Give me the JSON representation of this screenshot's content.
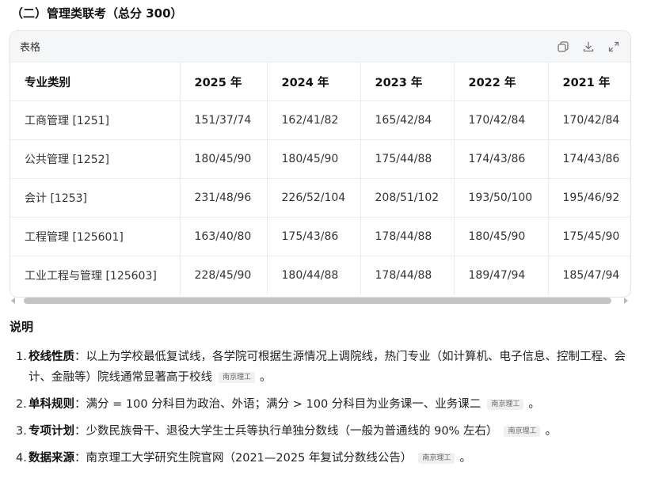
{
  "section_title": "（二）管理类联考（总分 300）",
  "table_card": {
    "label": "表格",
    "icons": [
      "copy-icon",
      "download-icon",
      "expand-icon"
    ]
  },
  "table": {
    "headers": [
      "专业类别",
      "2025 年",
      "2024 年",
      "2023 年",
      "2022 年",
      "2021 年"
    ],
    "rows": [
      [
        "工商管理 [1251]",
        "151/37/74",
        "162/41/82",
        "165/42/84",
        "170/42/84",
        "170/42/84"
      ],
      [
        "公共管理 [1252]",
        "180/45/90",
        "180/45/90",
        "175/44/88",
        "174/43/86",
        "174/43/86"
      ],
      [
        "会计 [1253]",
        "231/48/96",
        "226/52/104",
        "208/51/102",
        "193/50/100",
        "195/46/92"
      ],
      [
        "工程管理 [125601]",
        "163/40/80",
        "175/43/86",
        "178/44/88",
        "180/45/90",
        "175/45/90"
      ],
      [
        "工业工程与管理 [125603]",
        "228/45/90",
        "180/44/88",
        "178/44/88",
        "189/47/94",
        "185/47/94"
      ]
    ]
  },
  "notes_title": "说明",
  "notes": [
    {
      "num": "1.",
      "term": "校线性质",
      "text": "：以上为学校最低复试线，各学院可根据生源情况上调院线，热门专业（如计算机、电子信息、控制工程、会计、金融等）院线通常显著高于校线",
      "tag": "南京理工",
      "end": "。"
    },
    {
      "num": "2.",
      "term": "单科规则",
      "text": "：满分 = 100 分科目为政治、外语；满分 > 100 分科目为业务课一、业务课二",
      "tag": "南京理工",
      "end": "。"
    },
    {
      "num": "3.",
      "term": "专项计划",
      "text": "：少数民族骨干、退役大学生士兵等执行单独分数线（一般为普通线的 90% 左右）",
      "tag": "南京理工",
      "end": "。"
    },
    {
      "num": "4.",
      "term": "数据来源",
      "text": "：南京理工大学研究生院官网（2021—2025 年复试分数线公告）",
      "tag": "南京理工",
      "end": "。"
    }
  ]
}
